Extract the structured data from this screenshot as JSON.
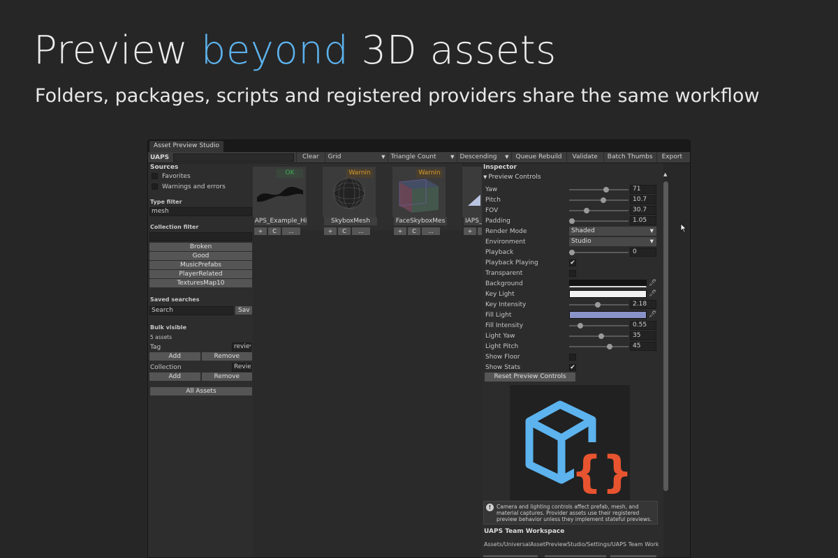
{
  "hero": {
    "title_pre": "Preview ",
    "title_accent": "beyond",
    "title_post": " 3D assets",
    "subtitle": "Folders, packages, scripts and registered providers share the same workflow",
    "accent_color": "#5cb3ee"
  },
  "window": {
    "title": "Asset Preview Studio"
  },
  "toolbar": {
    "label": "UAPS",
    "search_value": "",
    "clear": "Clear",
    "view_mode": "Grid",
    "sort_by": "Triangle Count",
    "order": "Descending",
    "queue_rebuild": "Queue Rebuild",
    "validate": "Validate",
    "batch_thumbs": "Batch Thumbs",
    "export": "Export"
  },
  "sidebar": {
    "sources_heading": "Sources",
    "favorites": "Favorites",
    "warnings": "Warnings and errors",
    "type_filter_heading": "Type filter",
    "type_filter_value": "mesh",
    "collection_filter_heading": "Collection filter",
    "collection_filter_value": "",
    "collections": [
      "Broken",
      "Good",
      "MusicPrefabs",
      "PlayerRelated",
      "TexturesMap10"
    ],
    "saved_searches_heading": "Saved searches",
    "saved_search_value": "Search",
    "save_label": "Sav",
    "bulk_heading": "Bulk visible",
    "bulk_count": "5 assets",
    "tag_label": "Tag",
    "tag_value": "reviev",
    "collection_label": "Collection",
    "collection_value": "Revie",
    "add": "Add",
    "remove": "Remove",
    "all_assets": "All Assets"
  },
  "assets": [
    {
      "name": "APS_Example_Hi",
      "status": "OK",
      "status_color": "#3fae5a",
      "buttons": [
        "+",
        "C",
        "..."
      ]
    },
    {
      "name": "SkyboxMesh",
      "status": "Warnin",
      "status_color": "#d69a2d",
      "buttons": [
        "+",
        "C",
        "..."
      ]
    },
    {
      "name": "FaceSkyboxMes",
      "status": "Warnin",
      "status_color": "#d69a2d",
      "buttons": [
        "+",
        "C",
        "..."
      ]
    },
    {
      "name": "IAPS_",
      "status": "",
      "status_color": "#d69a2d",
      "buttons": [
        "+",
        "C"
      ]
    }
  ],
  "inspector": {
    "heading": "Inspector",
    "foldout": "Preview Controls",
    "yaw_label": "Yaw",
    "yaw": "71",
    "yaw_level": 0.63,
    "pitch_label": "Pitch",
    "pitch": "10.7",
    "pitch_level": 0.58,
    "fov_label": "FOV",
    "fov": "30.7",
    "fov_level": 0.27,
    "padding_label": "Padding",
    "padding": "1.05",
    "padding_level": 0.0,
    "render_mode_label": "Render Mode",
    "render_mode": "Shaded",
    "environment_label": "Environment",
    "environment": "Studio",
    "playback_label": "Playback",
    "playback": "0",
    "playback_level": 0.0,
    "playback_playing_label": "Playback Playing",
    "playback_playing": true,
    "transparent_label": "Transparent",
    "transparent": false,
    "background_label": "Background",
    "background_color": "#141414",
    "key_light_label": "Key Light",
    "key_light_color": "#f2f2f2",
    "key_intensity_label": "Key Intensity",
    "key_intensity": "2.18",
    "key_intensity_level": 0.48,
    "fill_light_label": "Fill Light",
    "fill_light_color": "#8a93c9",
    "fill_intensity_label": "Fill Intensity",
    "fill_intensity": "0.55",
    "fill_intensity_level": 0.16,
    "light_yaw_label": "Light Yaw",
    "light_yaw": "35",
    "light_yaw_level": 0.55,
    "light_pitch_label": "Light Pitch",
    "light_pitch": "45",
    "light_pitch_level": 0.7,
    "show_floor_label": "Show Floor",
    "show_floor": false,
    "show_stats_label": "Show Stats",
    "show_stats": true,
    "reset_button": "Reset Preview Controls",
    "note": "Camera and lighting controls affect prefab, mesh, and material captures. Provider assets use their registered preview behavior unless they implement stateful previews.",
    "workspace_title": "UAPS Team Workspace",
    "workspace_path": "Assets/UniversalAssetPreviewStudio/Settings/UAPS Team Worksp",
    "preview_icon": "cube-script-icon",
    "preview_colors": {
      "cube": "#5cb3ee",
      "braces": "#e8542f"
    }
  }
}
